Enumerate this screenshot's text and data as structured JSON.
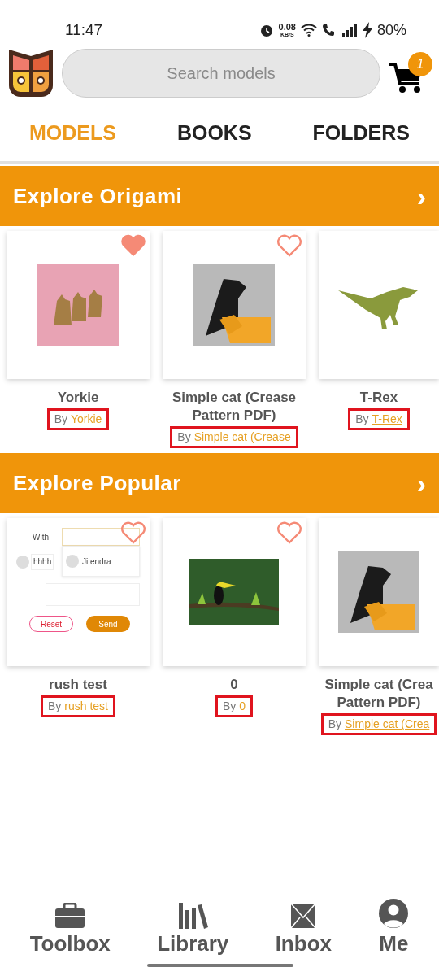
{
  "status_bar": {
    "time": "11:47",
    "speed": "0.08",
    "speed_unit": "KB/S",
    "battery": "80%"
  },
  "search": {
    "placeholder": "Search models"
  },
  "cart": {
    "badge": "1"
  },
  "tabs": [
    {
      "label": "MODELS",
      "selected": true
    },
    {
      "label": "BOOKS",
      "selected": false
    },
    {
      "label": "FOLDERS",
      "selected": false
    }
  ],
  "sections": [
    {
      "title": "Explore Origami",
      "chevron": "›",
      "items": [
        {
          "kind": "dogs",
          "title": "Yorkie",
          "by": "By",
          "author": "Yorkie",
          "favorite": true,
          "underlined": false,
          "highlighted": true
        },
        {
          "kind": "cat",
          "title": "Simple cat (Crease Pattern PDF)",
          "by": "By",
          "author": "Simple cat (Crease",
          "favorite": false,
          "underlined": true,
          "highlighted": true
        },
        {
          "kind": "dinosaur",
          "title": "T-Rex",
          "by": "By",
          "author": "T-Rex",
          "underlined": true,
          "highlighted": true
        }
      ]
    },
    {
      "title": "Explore Popular",
      "chevron": "›",
      "items": [
        {
          "kind": "screenshot",
          "title": "rush test",
          "by": "By",
          "author": "rush test",
          "favorite": false,
          "underlined": false,
          "highlighted": true,
          "screen": {
            "label": "With",
            "value": "hhhh",
            "suggestion": "Jitendra",
            "reset": "Reset",
            "send": "Send"
          }
        },
        {
          "kind": "bird",
          "title": "0",
          "by": "By",
          "author": "0",
          "favorite": false,
          "underlined": false,
          "highlighted": true
        },
        {
          "kind": "cat",
          "title": "Simple cat (Crea Pattern PDF)",
          "by": "By",
          "author": "Simple cat (Crea",
          "underlined": true,
          "highlighted": true
        }
      ]
    }
  ],
  "bottom_nav": [
    {
      "kind": "toolbox",
      "label": "Toolbox"
    },
    {
      "kind": "library",
      "label": "Library"
    },
    {
      "kind": "inbox",
      "label": "Inbox"
    },
    {
      "kind": "me",
      "label": "Me"
    }
  ]
}
